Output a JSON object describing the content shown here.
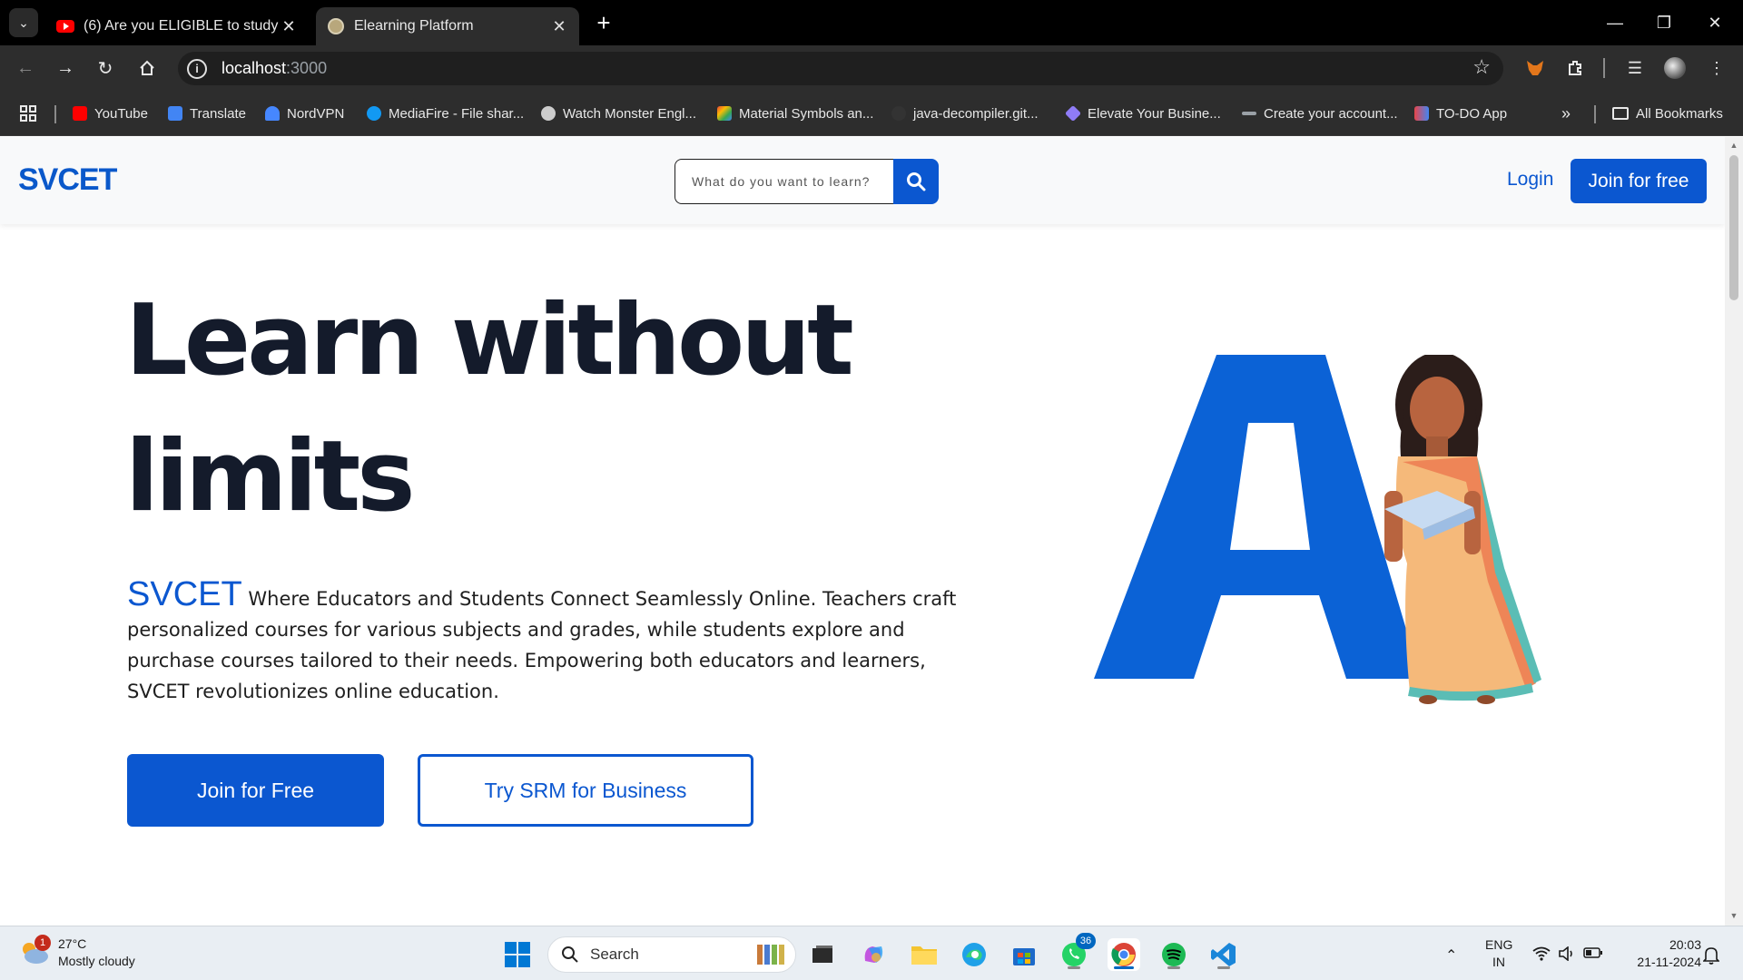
{
  "browser": {
    "tabs": [
      {
        "title": "(6) Are you ELIGIBLE to study in",
        "favicon": "youtube-icon",
        "active": false
      },
      {
        "title": "Elearning Platform",
        "favicon": "globe-icon",
        "active": true
      }
    ],
    "url_host": "localhost",
    "url_port": ":3000",
    "bookmarks": [
      {
        "label": "YouTube",
        "icon": "youtube-icon",
        "color": "#ff0000"
      },
      {
        "label": "Translate",
        "icon": "translate-icon",
        "color": "#4285f4"
      },
      {
        "label": "NordVPN",
        "icon": "nordvpn-icon",
        "color": "#4687ff"
      },
      {
        "label": "MediaFire - File shar...",
        "icon": "mediafire-icon",
        "color": "#1299f3"
      },
      {
        "label": "Watch Monster Engl...",
        "icon": "monster-icon",
        "color": "#cccccc"
      },
      {
        "label": "Material Symbols an...",
        "icon": "material-icon",
        "color": "#ea4335"
      },
      {
        "label": "java-decompiler.git...",
        "icon": "github-icon",
        "color": "#333333"
      },
      {
        "label": "Elevate Your Busine...",
        "icon": "diamond-icon",
        "color": "#8f7cf7"
      },
      {
        "label": "Create your account...",
        "icon": "account-icon",
        "color": "#9aa0a6"
      },
      {
        "label": "TO-DO App",
        "icon": "todo-icon",
        "color": "#e8454a"
      }
    ],
    "all_bookmarks_label": "All Bookmarks"
  },
  "site": {
    "logo": "SVCET",
    "search_placeholder": "What do you want to learn?",
    "login_label": "Login",
    "join_top_label": "Join for free",
    "hero_title": "Learn without limits",
    "hero_brand": "SVCET",
    "hero_description": " Where Educators and Students Connect Seamlessly Online. Teachers craft personalized courses for various subjects and grades, while students explore and purchase courses tailored to their needs. Empowering both educators and learners, SVCET revolutionizes online education.",
    "primary_button": "Join for Free",
    "secondary_button": "Try SRM for Business",
    "accent_color": "#0b57d0"
  },
  "taskbar": {
    "weather_temp": "27°C",
    "weather_text": "Mostly cloudy",
    "weather_badge": "1",
    "search_label": "Search",
    "whatsapp_badge": "36",
    "language_top": "ENG",
    "language_bottom": "IN",
    "time": "20:03",
    "date": "21-11-2024"
  }
}
